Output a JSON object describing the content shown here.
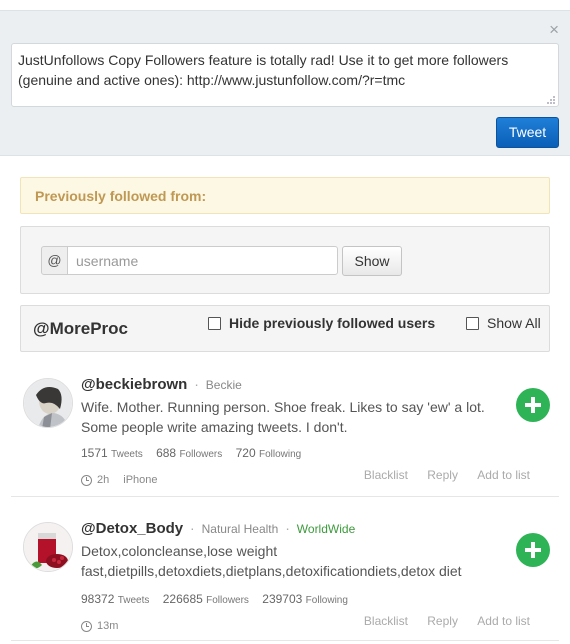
{
  "compose": {
    "tweet_text": "JustUnfollows Copy Followers feature is totally rad! Use it to get more followers (genuine and active ones): http://www.justunfollow.com/?r=tmc",
    "tweet_button": "Tweet",
    "close_glyph": "×"
  },
  "notice": {
    "text": "Previously followed from:"
  },
  "search": {
    "prefix": "@",
    "placeholder": "username",
    "show_button": "Show"
  },
  "filter": {
    "handle": "@MoreProc",
    "hide_label": "Hide previously followed users",
    "show_all_label": "Show All"
  },
  "users": [
    {
      "handle": "@beckiebrown",
      "name": "Beckie",
      "location": "",
      "bio": "Wife. Mother. Running person. Shoe freak. Likes to say 'ew' a lot. Some people write amazing tweets. I don't.",
      "tweets": "1571",
      "followers": "688",
      "following": "720",
      "time": "2h",
      "source": "iPhone"
    },
    {
      "handle": "@Detox_Body",
      "name": "Natural Health",
      "location": "WorldWide",
      "bio": "Detox,coloncleanse,lose weight fast,dietpills,detoxdiets,dietplans,detoxificationdiets,detox diet",
      "tweets": "98372",
      "followers": "226685",
      "following": "239703",
      "time": "13m",
      "source": ""
    }
  ],
  "labels": {
    "tweets": "Tweets",
    "followers": "Followers",
    "following": "Following",
    "blacklist": "Blacklist",
    "reply": "Reply",
    "add_to_list": "Add to list",
    "separator": "·"
  }
}
